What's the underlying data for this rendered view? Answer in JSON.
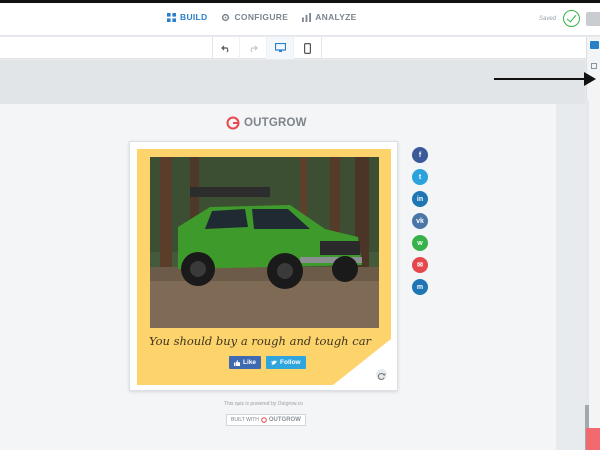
{
  "nav": {
    "build": "BUILD",
    "configure": "CONFIGURE",
    "analyze": "ANALYZE",
    "saved": "Saved"
  },
  "brand": {
    "logo_text": "OUTGROW"
  },
  "quiz": {
    "result_text": "You should buy a rough and tough car",
    "like_label": "Like",
    "follow_label": "Follow"
  },
  "footer": {
    "powered_by": "This quiz is powered by Outgrow.co",
    "built_with": "BUILT WITH",
    "built_brand": "OUTGROW"
  },
  "social": [
    {
      "name": "facebook",
      "glyph": "f",
      "color": "#3b5a9a"
    },
    {
      "name": "twitter",
      "glyph": "t",
      "color": "#2aa3dd"
    },
    {
      "name": "linkedin",
      "glyph": "in",
      "color": "#1f76b5"
    },
    {
      "name": "vk",
      "glyph": "vk",
      "color": "#4a76a8"
    },
    {
      "name": "whatsapp",
      "glyph": "w",
      "color": "#37b14a"
    },
    {
      "name": "email",
      "glyph": "✉",
      "color": "#e4474c"
    },
    {
      "name": "messenger",
      "glyph": "m",
      "color": "#1f76b5"
    }
  ],
  "colors": {
    "accent": "#2a7fc9",
    "card_fill": "#fdd36b",
    "saved_check": "#38b24a"
  }
}
